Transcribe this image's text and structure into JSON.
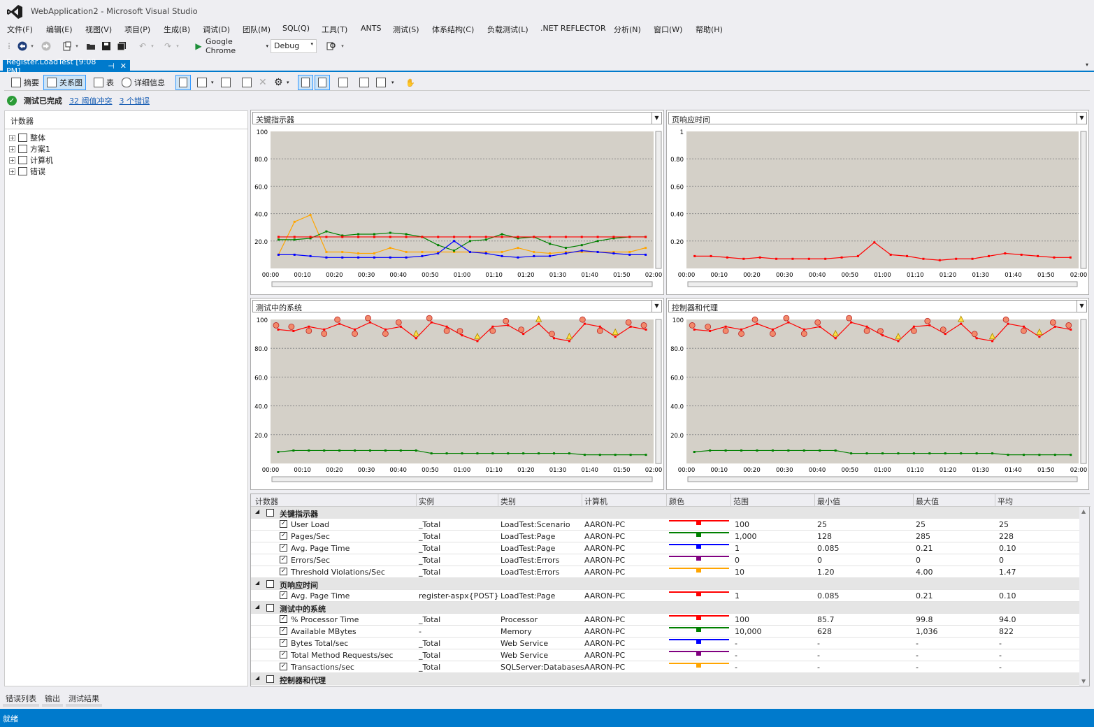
{
  "app": {
    "title": "WebApplication2 - Microsoft Visual Studio"
  },
  "menu": [
    "文件(F)",
    "编辑(E)",
    "视图(V)",
    "项目(P)",
    "生成(B)",
    "调试(D)",
    "团队(M)",
    "SQL(Q)",
    "工具(T)",
    "ANTS",
    "测试(S)",
    "体系结构(C)",
    "负载测试(L)",
    ".NET REFLECTOR",
    "分析(N)",
    "窗口(W)",
    "帮助(H)"
  ],
  "toolbar": {
    "browser": "Google Chrome",
    "config": "Debug"
  },
  "doc_tab": {
    "label": "Register.LoadTest [9:08 PM]",
    "pin": "⊣",
    "close": "✕"
  },
  "view_buttons": {
    "summary": "摘要",
    "graphs": "关系图",
    "tables": "表",
    "details": "详细信息"
  },
  "status": {
    "completed": "测试已完成",
    "threshold": "32 阈值冲突",
    "errors": "3 个错误"
  },
  "counters": {
    "header": "计数器",
    "items": [
      {
        "label": "整体"
      },
      {
        "label": "方案1"
      },
      {
        "label": "计算机"
      },
      {
        "label": "错误"
      }
    ]
  },
  "graphs": [
    {
      "title": "关键指示器",
      "ylabels": [
        "100",
        "80.0",
        "60.0",
        "40.0",
        "20.0"
      ]
    },
    {
      "title": "页响应时间",
      "ylabels": [
        "1",
        "0.80",
        "0.60",
        "0.40",
        "0.20"
      ]
    },
    {
      "title": "测试中的系统",
      "ylabels": [
        "100",
        "80.0",
        "60.0",
        "40.0",
        "20.0"
      ]
    },
    {
      "title": "控制器和代理",
      "ylabels": [
        "100",
        "80.0",
        "60.0",
        "40.0",
        "20.0"
      ]
    }
  ],
  "xlabels": [
    "00:00",
    "00:10",
    "00:20",
    "00:30",
    "00:40",
    "00:50",
    "01:00",
    "01:10",
    "01:20",
    "01:30",
    "01:40",
    "01:50",
    "02:00"
  ],
  "colors": {
    "red": "#ff0000",
    "green": "#008000",
    "blue": "#0000ff",
    "purple": "#800080",
    "orange": "#ffa500",
    "accent": "#007acc"
  },
  "grid": {
    "columns": [
      "计数器",
      "实例",
      "类别",
      "计算机",
      "颜色",
      "范围",
      "最小值",
      "最大值",
      "平均"
    ],
    "groups": [
      {
        "name": "关键指示器",
        "rows": [
          {
            "counter": "User Load",
            "instance": "_Total",
            "category": "LoadTest:Scenario",
            "computer": "AARON-PC",
            "color": "#ff0000",
            "range": "100",
            "min": "25",
            "max": "25",
            "avg": "25"
          },
          {
            "counter": "Pages/Sec",
            "instance": "_Total",
            "category": "LoadTest:Page",
            "computer": "AARON-PC",
            "color": "#008000",
            "range": "1,000",
            "min": "128",
            "max": "285",
            "avg": "228"
          },
          {
            "counter": "Avg. Page Time",
            "instance": "_Total",
            "category": "LoadTest:Page",
            "computer": "AARON-PC",
            "color": "#0000ff",
            "range": "1",
            "min": "0.085",
            "max": "0.21",
            "avg": "0.10"
          },
          {
            "counter": "Errors/Sec",
            "instance": "_Total",
            "category": "LoadTest:Errors",
            "computer": "AARON-PC",
            "color": "#800080",
            "range": "0",
            "min": "0",
            "max": "0",
            "avg": "0"
          },
          {
            "counter": "Threshold Violations/Sec",
            "instance": "_Total",
            "category": "LoadTest:Errors",
            "computer": "AARON-PC",
            "color": "#ffa500",
            "range": "10",
            "min": "1.20",
            "max": "4.00",
            "avg": "1.47"
          }
        ]
      },
      {
        "name": "页响应时间",
        "rows": [
          {
            "counter": "Avg. Page Time",
            "instance": "register-aspx{POST}",
            "category": "LoadTest:Page",
            "computer": "AARON-PC",
            "color": "#ff0000",
            "range": "1",
            "min": "0.085",
            "max": "0.21",
            "avg": "0.10"
          }
        ]
      },
      {
        "name": "测试中的系统",
        "rows": [
          {
            "counter": "% Processor Time",
            "instance": "_Total",
            "category": "Processor",
            "computer": "AARON-PC",
            "color": "#ff0000",
            "range": "100",
            "min": "85.7",
            "max": "99.8",
            "avg": "94.0"
          },
          {
            "counter": "Available MBytes",
            "instance": "-",
            "category": "Memory",
            "computer": "AARON-PC",
            "color": "#008000",
            "range": "10,000",
            "min": "628",
            "max": "1,036",
            "avg": "822"
          },
          {
            "counter": "Bytes Total/sec",
            "instance": "_Total",
            "category": "Web Service",
            "computer": "AARON-PC",
            "color": "#0000ff",
            "range": "-",
            "min": "-",
            "max": "-",
            "avg": "-"
          },
          {
            "counter": "Total Method Requests/sec",
            "instance": "_Total",
            "category": "Web Service",
            "computer": "AARON-PC",
            "color": "#800080",
            "range": "-",
            "min": "-",
            "max": "-",
            "avg": "-"
          },
          {
            "counter": "Transactions/sec",
            "instance": "_Total",
            "category": "SQLServer:Databases",
            "computer": "AARON-PC",
            "color": "#ffa500",
            "range": "-",
            "min": "-",
            "max": "-",
            "avg": "-"
          }
        ]
      },
      {
        "name": "控制器和代理",
        "rows": []
      }
    ]
  },
  "bottom_tabs": [
    "错误列表",
    "输出",
    "测试结果"
  ],
  "statusbar": {
    "text": "就绪"
  }
}
